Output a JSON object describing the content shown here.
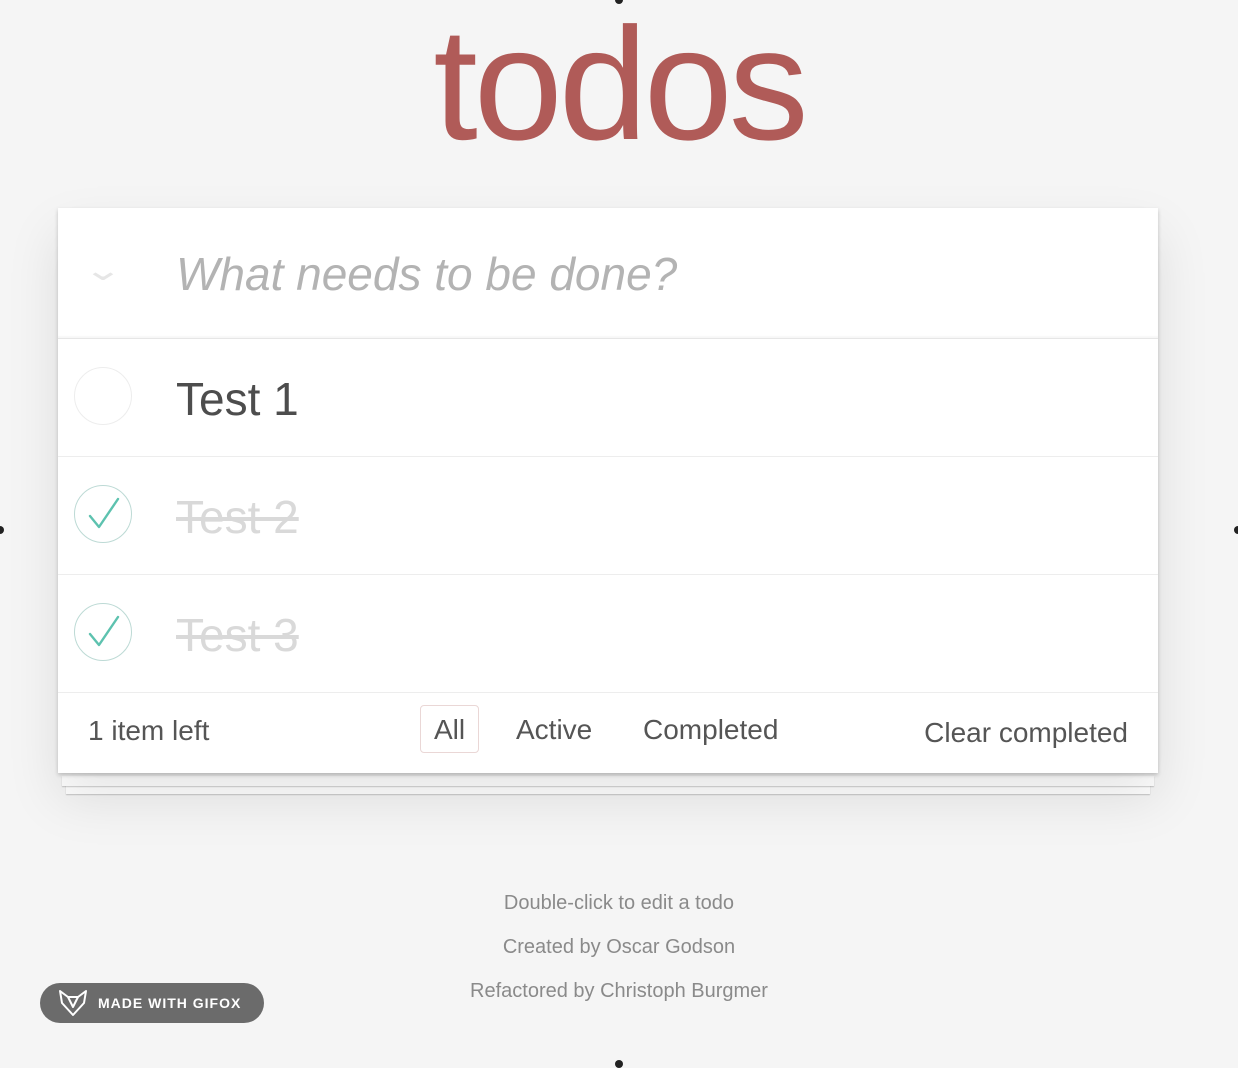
{
  "app": {
    "title": "todos"
  },
  "new_todo": {
    "placeholder": "What needs to be done?",
    "value": ""
  },
  "todos": [
    {
      "label": "Test 1",
      "completed": false
    },
    {
      "label": "Test 2",
      "completed": true
    },
    {
      "label": "Test 3",
      "completed": true
    }
  ],
  "footer": {
    "count_text": "1 item left",
    "filters": [
      {
        "label": "All",
        "selected": true
      },
      {
        "label": "Active",
        "selected": false
      },
      {
        "label": "Completed",
        "selected": false
      }
    ],
    "clear_completed_label": "Clear completed"
  },
  "info": {
    "line1": "Double-click to edit a todo",
    "line2": "Created by Oscar Godson",
    "line3": "Refactored by Christoph Burgmer"
  },
  "badge": {
    "text": "MADE WITH GIFOX",
    "icon": "fox-icon"
  },
  "colors": {
    "title": "#b05b58",
    "check": "#5dc2af",
    "check_border": "#bddad5",
    "selected_filter_border": "#ead7d6"
  }
}
